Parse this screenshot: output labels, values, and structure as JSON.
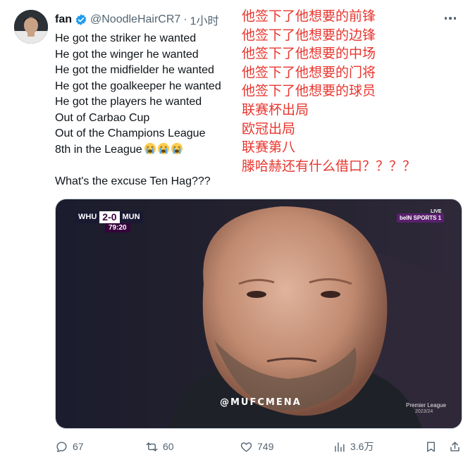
{
  "tweet": {
    "author_name": "fan",
    "handle": "@NoodleHairCR7",
    "separator": "·",
    "time": "1小时",
    "lines_en": [
      "He got the striker he wanted",
      "He got the winger he wanted",
      "He got the midfielder he wanted",
      "He got the goalkeeper he wanted",
      "He got the players he wanted",
      "Out of Carbao Cup",
      "Out of the Champions League",
      "8th in the League"
    ],
    "question": "What's the excuse Ten Hag???",
    "lines_cn": [
      "他签下了他想要的前锋",
      "他签下了他想要的边锋",
      "他签下了他想要的中场",
      "他签下了他想要的门将",
      "他签下了他想要的球员",
      "联赛杯出局",
      "欧冠出局",
      "联赛第八",
      "滕哈赫还有什么借口？？？？"
    ]
  },
  "media": {
    "home_team": "WHU",
    "score": "2-0",
    "away_team": "MUN",
    "clock": "79:20",
    "broadcaster": "beIN SPORTS 1",
    "live": "LIVE",
    "watermark": "@MUFCMENA",
    "league_logo_text": "Premier League",
    "season": "2023/24"
  },
  "actions": {
    "replies": "67",
    "reposts": "60",
    "likes": "749",
    "views": "3.6万"
  },
  "colors": {
    "verified": "#1d9bf0",
    "translation_red": "#e8352e",
    "muted": "#536471"
  }
}
